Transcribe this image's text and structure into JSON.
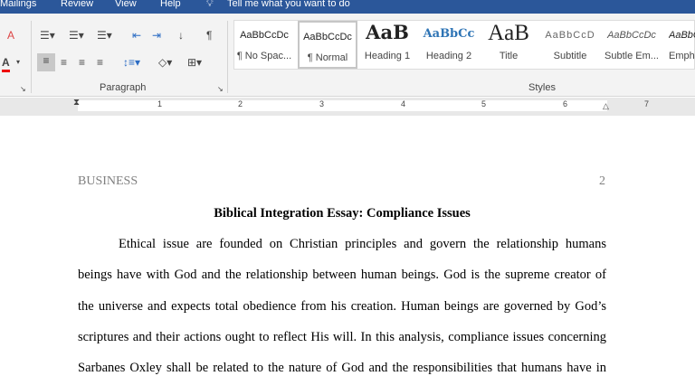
{
  "tabs": [
    "Mailings",
    "Review",
    "View",
    "Help"
  ],
  "tell_me": "Tell me what you want to do",
  "groups": {
    "paragraph": "Paragraph",
    "styles": "Styles"
  },
  "styles": [
    {
      "preview": "AaBbCcDc",
      "name": "¶ No Spac..."
    },
    {
      "preview": "AaBbCcDc",
      "name": "¶ Normal"
    },
    {
      "preview": "AaB",
      "name": "Heading 1"
    },
    {
      "preview": "AaBbCc",
      "name": "Heading 2"
    },
    {
      "preview": "AaB",
      "name": "Title"
    },
    {
      "preview": "AaBbCcD",
      "name": "Subtitle"
    },
    {
      "preview": "AaBbCcDc",
      "name": "Subtle Em..."
    },
    {
      "preview": "AaBbC",
      "name": "Emph"
    }
  ],
  "ruler": [
    "1",
    "2",
    "3",
    "4",
    "5",
    "6",
    "7"
  ],
  "document": {
    "header": "BUSINESS",
    "page_number": "2",
    "title": "Biblical Integration Essay: Compliance Issues",
    "lines": [
      "Ethical issue are founded on Christian principles and govern the relationship humans",
      "beings have with God and the relationship between human beings. God is the supreme creator of",
      "the universe and expects total obedience from his creation. Human beings are governed by God’s",
      "scriptures and their actions ought to reflect His will. In this analysis, compliance issues concerning",
      "Sarbanes Oxley shall be related to the nature of God and the responsibilities that humans have in"
    ]
  }
}
